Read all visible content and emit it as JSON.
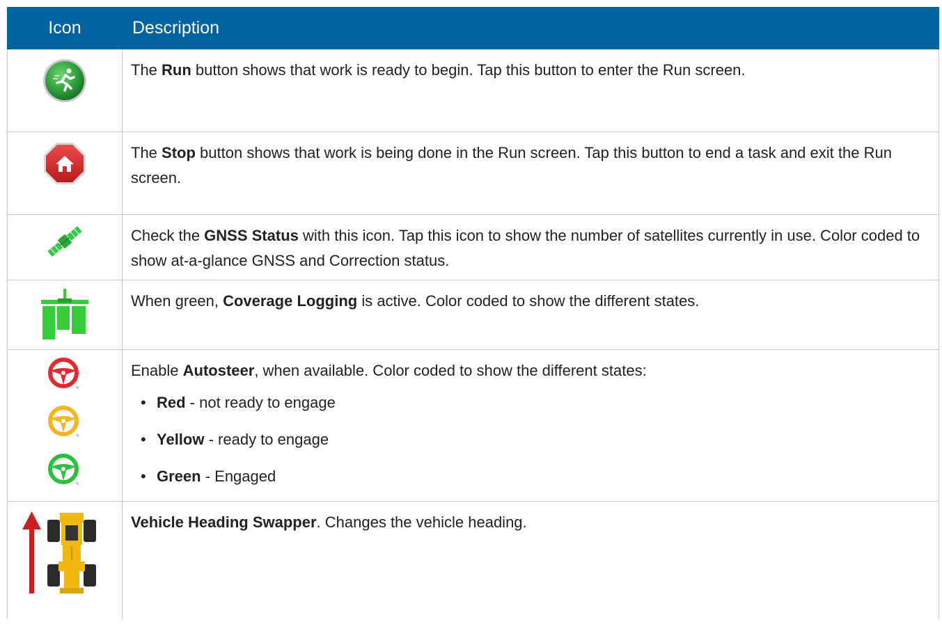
{
  "header": {
    "icon_col": "Icon",
    "desc_col": "Description"
  },
  "rows": {
    "run": {
      "icon": "run-button-icon",
      "pre": "The ",
      "bold": "Run",
      "post": " button shows that work is ready to begin. Tap this button to enter the Run screen."
    },
    "stop": {
      "icon": "stop-home-icon",
      "pre": "The ",
      "bold": "Stop",
      "post": " button shows that work is being done in the Run screen. Tap this button to end a task and exit the Run screen."
    },
    "gnss": {
      "icon": "satellite-icon",
      "pre": "Check the ",
      "bold": "GNSS Status",
      "post": " with this icon. Tap this icon to show the number of satellites currently in use. Color coded to show at-a-glance GNSS and Correction status."
    },
    "coverage": {
      "icon": "coverage-logging-icon",
      "pre": "When green, ",
      "bold": "Coverage Logging",
      "post": " is active. Color coded to show the different states."
    },
    "autosteer": {
      "icons": [
        "steering-wheel-red-icon",
        "steering-wheel-yellow-icon",
        "steering-wheel-green-icon"
      ],
      "pre": "Enable ",
      "bold": "Autosteer",
      "post": ", when available. Color coded to show the different states:",
      "bullet": "•",
      "states": [
        {
          "bold": "Red",
          "text": " - not ready to engage"
        },
        {
          "bold": "Yellow",
          "text": " - ready to engage"
        },
        {
          "bold": "Green",
          "text": " - Engaged"
        }
      ]
    },
    "vehicle": {
      "icon": "vehicle-heading-icon",
      "bold": "Vehicle Heading Swapper",
      "post": ". Changes the vehicle heading."
    }
  },
  "colors": {
    "header_bg": "#0163a2",
    "run_green": "#2e9e3a",
    "stop_red": "#d42a2a",
    "gnss_green": "#35c94a",
    "coverage_green": "#38cc3a",
    "steer_red": "#e8262e",
    "steer_yellow": "#f6b519",
    "steer_green": "#2cc13a",
    "vehicle_yellow": "#f1b90f",
    "arrow_red": "#cc1f1f"
  }
}
